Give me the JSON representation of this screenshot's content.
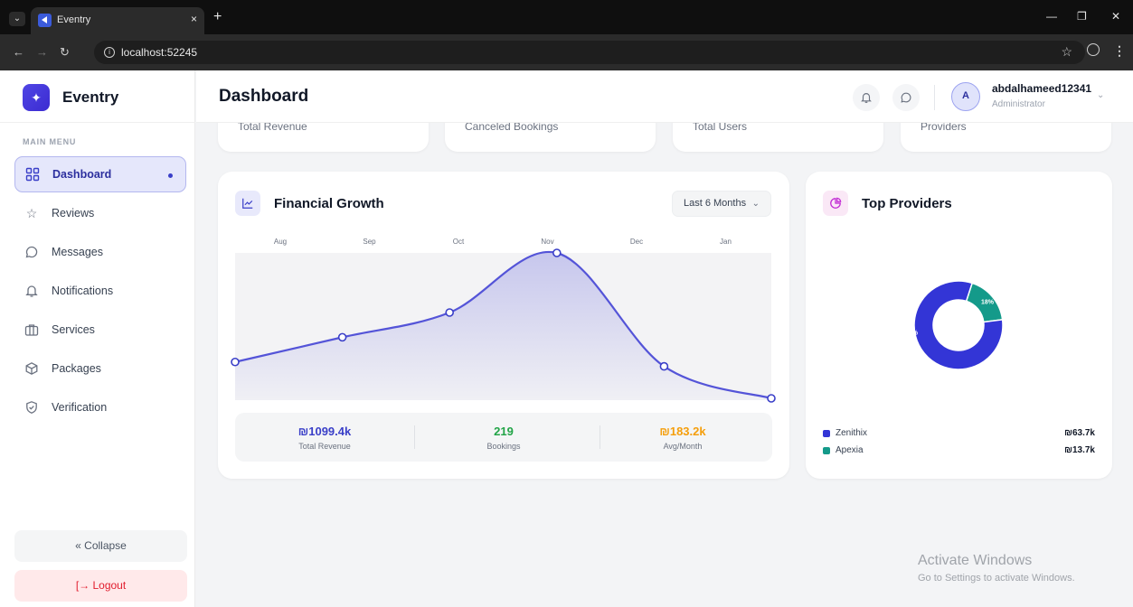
{
  "browser": {
    "tab_title": "Eventry",
    "tab_close": "×",
    "new_tab": "+",
    "url": "localhost:52245",
    "controls": {
      "minimize": "—",
      "restore": "❐",
      "close": "✕"
    }
  },
  "sidebar": {
    "brand": "Eventry",
    "menu_caption": "MAIN MENU",
    "items": [
      {
        "label": "Dashboard",
        "icon": "grid-icon",
        "active": true
      },
      {
        "label": "Reviews",
        "icon": "star-icon"
      },
      {
        "label": "Messages",
        "icon": "chat-icon"
      },
      {
        "label": "Notifications",
        "icon": "bell-icon"
      },
      {
        "label": "Services",
        "icon": "briefcase-icon"
      },
      {
        "label": "Packages",
        "icon": "package-icon"
      },
      {
        "label": "Verification",
        "icon": "shield-check-icon"
      }
    ],
    "collapse": "« Collapse",
    "logout": "[→ Logout"
  },
  "header": {
    "title": "Dashboard",
    "user": {
      "initial": "A",
      "name": "abdalhameed12341",
      "role": "Administrator"
    }
  },
  "stats": [
    "Total Revenue",
    "Canceled Bookings",
    "Total Users",
    "Providers"
  ],
  "financial": {
    "title": "Financial Growth",
    "range": "Last 6 Months",
    "accent": "#5454d8",
    "summary": [
      {
        "value": "₪1099.4k",
        "label": "Total Revenue",
        "color": "#3a3fc8"
      },
      {
        "value": "219",
        "label": "Bookings",
        "color": "#22a447"
      },
      {
        "value": "₪183.2k",
        "label": "Avg/Month",
        "color": "#f59e0b"
      }
    ]
  },
  "providers": {
    "title": "Top Providers",
    "items": [
      {
        "name": "Zenithix",
        "value": "₪63.7k",
        "color": "#3335d6"
      },
      {
        "name": "Apexia",
        "value": "₪13.7k",
        "color": "#149a8a"
      }
    ]
  },
  "chart_data": [
    {
      "type": "line",
      "categories": [
        "Aug",
        "Sep",
        "Oct",
        "Nov",
        "Dec",
        "Jan"
      ],
      "series": [
        {
          "values": [
            0.25,
            0.42,
            0.59,
            1.0,
            0.22,
            0.0
          ]
        }
      ]
    },
    {
      "type": "pie",
      "categories": [
        "Zenithix",
        "Apexia"
      ],
      "values": [
        82,
        18
      ],
      "labels": [
        "82%",
        "18%"
      ]
    }
  ],
  "watermark": {
    "line1": "Activate Windows",
    "line2": "Go to Settings to activate Windows."
  }
}
